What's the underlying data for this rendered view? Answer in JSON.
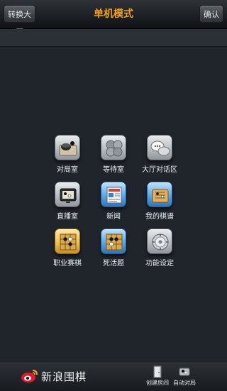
{
  "header": {
    "left_button": "转换大厅",
    "title": "单机模式",
    "right_button": "确认"
  },
  "menu": {
    "items": [
      {
        "label": "对局室",
        "icon": "board-stones-icon"
      },
      {
        "label": "等待室",
        "icon": "stone-bowls-icon"
      },
      {
        "label": "大厅对话区",
        "icon": "chat-bubbles-icon"
      },
      {
        "label": "直播室",
        "icon": "tv-broadcast-icon"
      },
      {
        "label": "新闻",
        "icon": "newspaper-icon"
      },
      {
        "label": "我的棋谱",
        "icon": "record-book-icon"
      },
      {
        "label": "职业赛棋",
        "icon": "pro-board-icon"
      },
      {
        "label": "死活题",
        "icon": "problem-board-icon"
      },
      {
        "label": "功能设定",
        "icon": "settings-dial-icon"
      }
    ]
  },
  "footer": {
    "logo_text": "新浪围棋",
    "create_room": "创建房间",
    "auto_match": "自动对局"
  },
  "colors": {
    "title": "#f0a020",
    "background": "#1f252b"
  }
}
